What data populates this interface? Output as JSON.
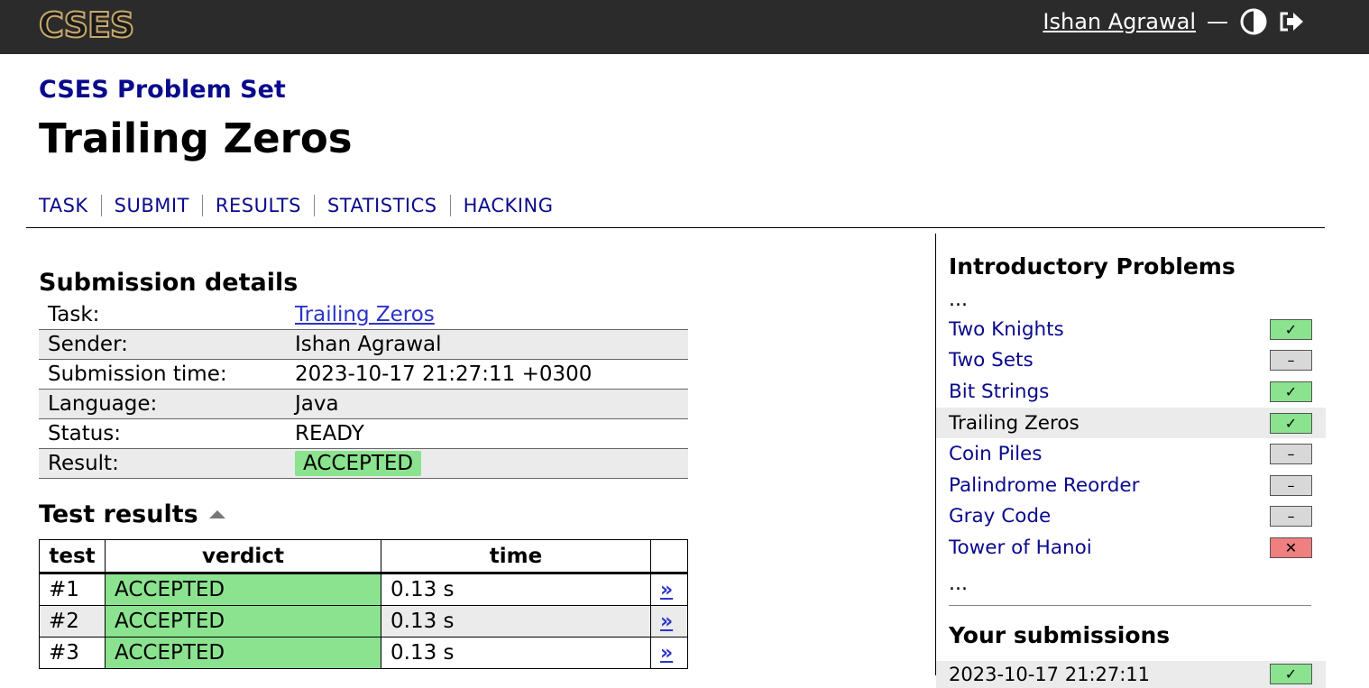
{
  "header": {
    "logo_text": "CSES",
    "username": "Ishan Agrawal",
    "separator": "—",
    "theme_icon": "contrast-icon",
    "logout_icon": "logout-icon"
  },
  "page": {
    "problemset": "CSES Problem Set",
    "title": "Trailing Zeros",
    "tabs": [
      "TASK",
      "SUBMIT",
      "RESULTS",
      "STATISTICS",
      "HACKING"
    ]
  },
  "details": {
    "heading": "Submission details",
    "rows": [
      {
        "key": "Task:",
        "value": "Trailing Zeros"
      },
      {
        "key": "Sender:",
        "value": "Ishan Agrawal"
      },
      {
        "key": "Submission time:",
        "value": "2023-10-17 21:27:11 +0300"
      },
      {
        "key": "Language:",
        "value": "Java"
      },
      {
        "key": "Status:",
        "value": "READY"
      },
      {
        "key": "Result:",
        "value": "ACCEPTED"
      }
    ]
  },
  "tests": {
    "heading": "Test results",
    "columns": [
      "test",
      "verdict",
      "time",
      ""
    ],
    "rows": [
      {
        "test": "#1",
        "verdict": "ACCEPTED",
        "time": "0.13 s",
        "link": "»"
      },
      {
        "test": "#2",
        "verdict": "ACCEPTED",
        "time": "0.13 s",
        "link": "»"
      },
      {
        "test": "#3",
        "verdict": "ACCEPTED",
        "time": "0.13 s",
        "link": "»"
      }
    ]
  },
  "sidebar": {
    "heading": "Introductory Problems",
    "ellipsis_top": "...",
    "ellipsis_bottom": "...",
    "problems": [
      {
        "name": "Two Knights",
        "status": "ok",
        "mark": "✓"
      },
      {
        "name": "Two Sets",
        "status": "none",
        "mark": "–"
      },
      {
        "name": "Bit Strings",
        "status": "ok",
        "mark": "✓"
      },
      {
        "name": "Trailing Zeros",
        "status": "ok",
        "mark": "✓"
      },
      {
        "name": "Coin Piles",
        "status": "none",
        "mark": "–"
      },
      {
        "name": "Palindrome Reorder",
        "status": "none",
        "mark": "–"
      },
      {
        "name": "Gray Code",
        "status": "none",
        "mark": "–"
      },
      {
        "name": "Tower of Hanoi",
        "status": "fail",
        "mark": "✕"
      }
    ],
    "submissions_heading": "Your submissions",
    "submissions": [
      {
        "time": "2023-10-17 21:27:11",
        "mark": "✓"
      }
    ]
  },
  "colors": {
    "header_bg": "#2b2b2b",
    "link": "#0a0a8c",
    "accepted": "#8be38f",
    "failed": "#f07f7f",
    "pending": "#d8d8d8"
  }
}
